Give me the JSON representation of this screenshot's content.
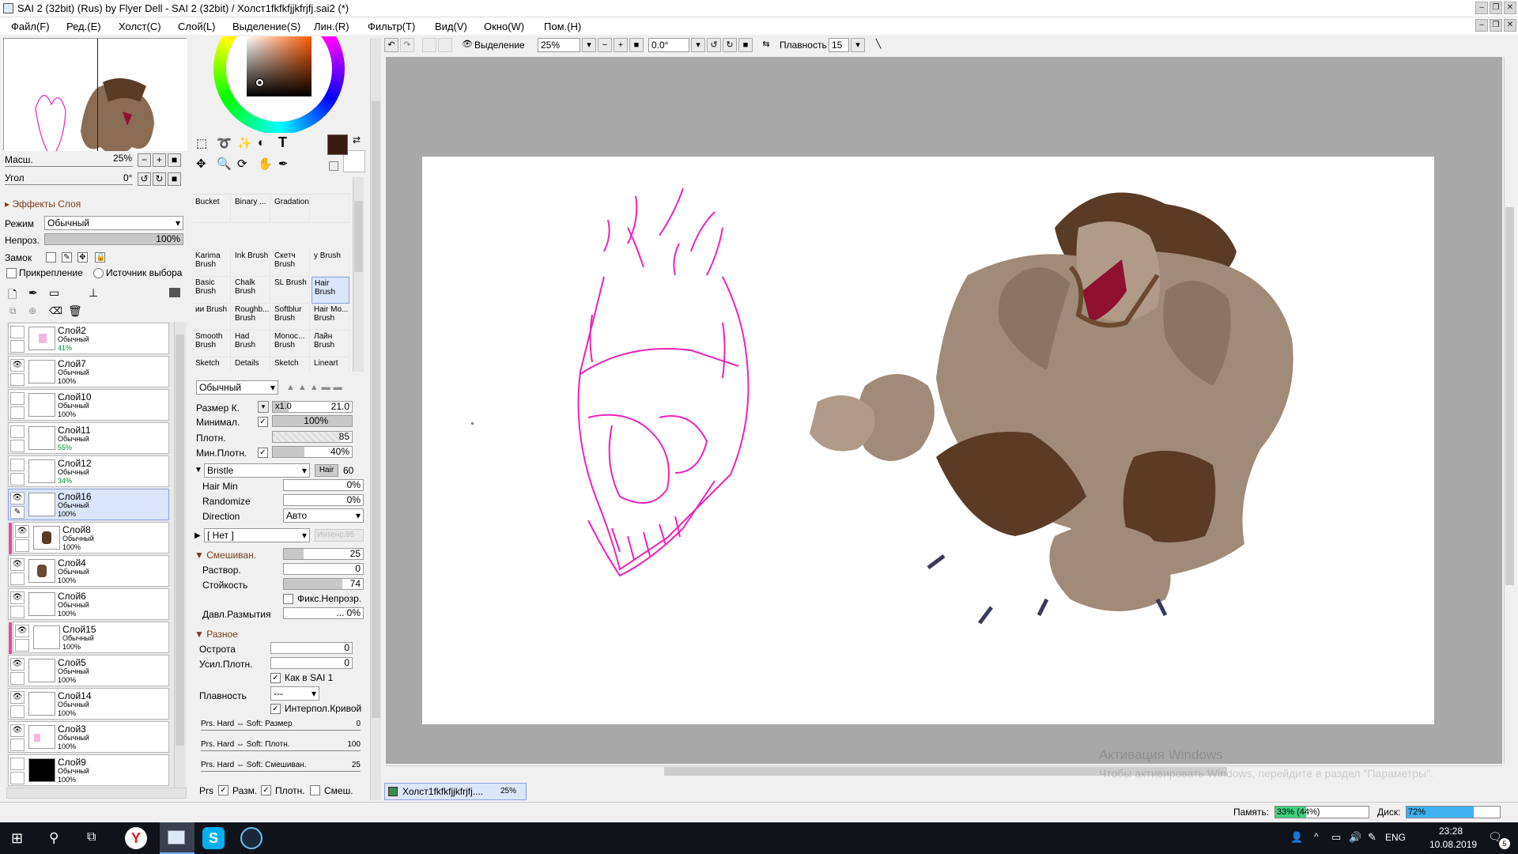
{
  "window": {
    "title": "SAI 2 (32bit) (Rus) by Flyer Dell - SAI 2 (32bit) / Холст1fkfkfjjkfrjfj.sai2 (*)"
  },
  "menu": [
    "Файл(F)",
    "Ред.(E)",
    "Холст(C)",
    "Слой(L)",
    "Выделение(S)",
    "Лин.(R)",
    "Фильтр(T)",
    "Вид(V)",
    "Окно(W)",
    "Пом.(H)"
  ],
  "toolbar": {
    "selection_label": "Выделение",
    "zoom": "25%",
    "angle": "0.0°",
    "smooth_label": "Плавность",
    "smooth_value": "15"
  },
  "navigator": {
    "scale_label": "Масш.",
    "scale_value": "25%",
    "angle_label": "Угол",
    "angle_value": "0°"
  },
  "layer_props": {
    "effects_label": "Эффекты Слоя",
    "mode_label": "Режим",
    "mode_value": "Обычный",
    "opacity_label": "Непроз.",
    "opacity_value": "100%",
    "lock_label": "Замок",
    "clip_label": "Прикрепление",
    "source_label": "Источник выбора"
  },
  "layers": [
    {
      "name": "Слой2",
      "mode": "Обычный",
      "opacity": "41%"
    },
    {
      "name": "Слой7",
      "mode": "Обычный",
      "opacity": "100%"
    },
    {
      "name": "Слой10",
      "mode": "Обычный",
      "opacity": "100%"
    },
    {
      "name": "Слой11",
      "mode": "Обычный",
      "opacity": "55%"
    },
    {
      "name": "Слой12",
      "mode": "Обычный",
      "opacity": "34%"
    },
    {
      "name": "Слой16",
      "mode": "Обычный",
      "opacity": "100%"
    },
    {
      "name": "Слой8",
      "mode": "Обычный",
      "opacity": "100%"
    },
    {
      "name": "Слой4",
      "mode": "Обычный",
      "opacity": "100%"
    },
    {
      "name": "Слой6",
      "mode": "Обычный",
      "opacity": "100%"
    },
    {
      "name": "Слой15",
      "mode": "Обычный",
      "opacity": "100%"
    },
    {
      "name": "Слой5",
      "mode": "Обычный",
      "opacity": "100%"
    },
    {
      "name": "Слой14",
      "mode": "Обычный",
      "opacity": "100%"
    },
    {
      "name": "Слой3",
      "mode": "Обычный",
      "opacity": "100%"
    },
    {
      "name": "Слой9",
      "mode": "Обычный",
      "opacity": "100%"
    }
  ],
  "brushes": {
    "row0": [
      "Bucket",
      "Binary ...",
      "Gradation"
    ],
    "row1": [
      "Karima Brush",
      "Ink Brush",
      "Скетч Brush",
      "у Brush"
    ],
    "row2": [
      "Basic Brush",
      "Chalk Brush",
      "SL Brush",
      "Hair Brush"
    ],
    "row3": [
      "ии Brush",
      "Roughb... Brush",
      "Softblur Brush",
      "Hair Mo... Brush"
    ],
    "row4": [
      "Smooth Brush",
      "Had Brush",
      "Monoc... Brush",
      "Лайн Brush"
    ],
    "row5": [
      "Sketch",
      "Details",
      "Sketch",
      "Lineart"
    ]
  },
  "brush_settings": {
    "blend_mode": "Обычный",
    "size_label": "Размер К.",
    "size_mult": "x1.0",
    "size_value": "21.0",
    "min_label": "Минимал.",
    "min_value": "100%",
    "density_label": "Плотн.",
    "density_value": "85",
    "min_density_label": "Мин.Плотн.",
    "min_density_value": "40%",
    "shape": "Bristle",
    "shape_tag": "Hair",
    "shape_value": "60",
    "hair_min_label": "Hair Min",
    "hair_min_value": "0%",
    "randomize_label": "Randomize",
    "randomize_value": "0%",
    "direction_label": "Direction",
    "direction_value": "Авто",
    "texture": "[ Нет ]",
    "texture_intensity": "Интенс.95",
    "mixing_label": "Смешиван.",
    "mixing_value": "25",
    "dilution_label": "Раствор.",
    "dilution_value": "0",
    "persistence_label": "Стойкость",
    "persistence_value": "74",
    "fix_opacity_label": "Фикс.Непрозр.",
    "blur_label": "Давл.Размытия",
    "blur_value": "... 0%",
    "misc_label": "Разное",
    "sharp_label": "Острота",
    "sharp_value": "0",
    "boost_label": "Усил.Плотн.",
    "boost_value": "0",
    "sai1_label": "Как в SAI 1",
    "smooth_label": "Плавность",
    "smooth_value": "---",
    "interp_label": "Интерпол.Кривой",
    "prs_size_label": "Prs. Hard ⇔ Soft: Размер",
    "prs_size_value": "0",
    "prs_dens_label": "Prs. Hard ⇔ Soft: Плотн.",
    "prs_dens_value": "100",
    "prs_mix_label": "Prs. Hard ⇔ Soft: Смешиван.",
    "prs_mix_value": "25",
    "prs_label": "Prs",
    "prs_size": "Разм.",
    "prs_dens": "Плотн.",
    "prs_mix": "Смеш."
  },
  "colors": {
    "primary": "#3a1a10",
    "secondary": "#ffffff",
    "sketch": "#ee22bb",
    "fur": "#6b4a32",
    "skin": "#a08a78",
    "mouth": "#8f1030"
  },
  "doc_tab": {
    "name": "Холст1fkfkfjjkfrjfj....",
    "zoom": "25%"
  },
  "status": {
    "memory_label": "Память:",
    "memory_value": "33% (44%)",
    "memory_pct": 0.33,
    "disk_label": "Диск:",
    "disk_value": "72%",
    "disk_pct": 0.72
  },
  "watermark": {
    "line1": "Активация Windows",
    "line2": "Чтобы активировать Windows, перейдите в раздел \"Параметры\"."
  },
  "taskbar": {
    "lang": "ENG",
    "time": "23:28",
    "date": "10.08.2019",
    "notif": "5"
  }
}
